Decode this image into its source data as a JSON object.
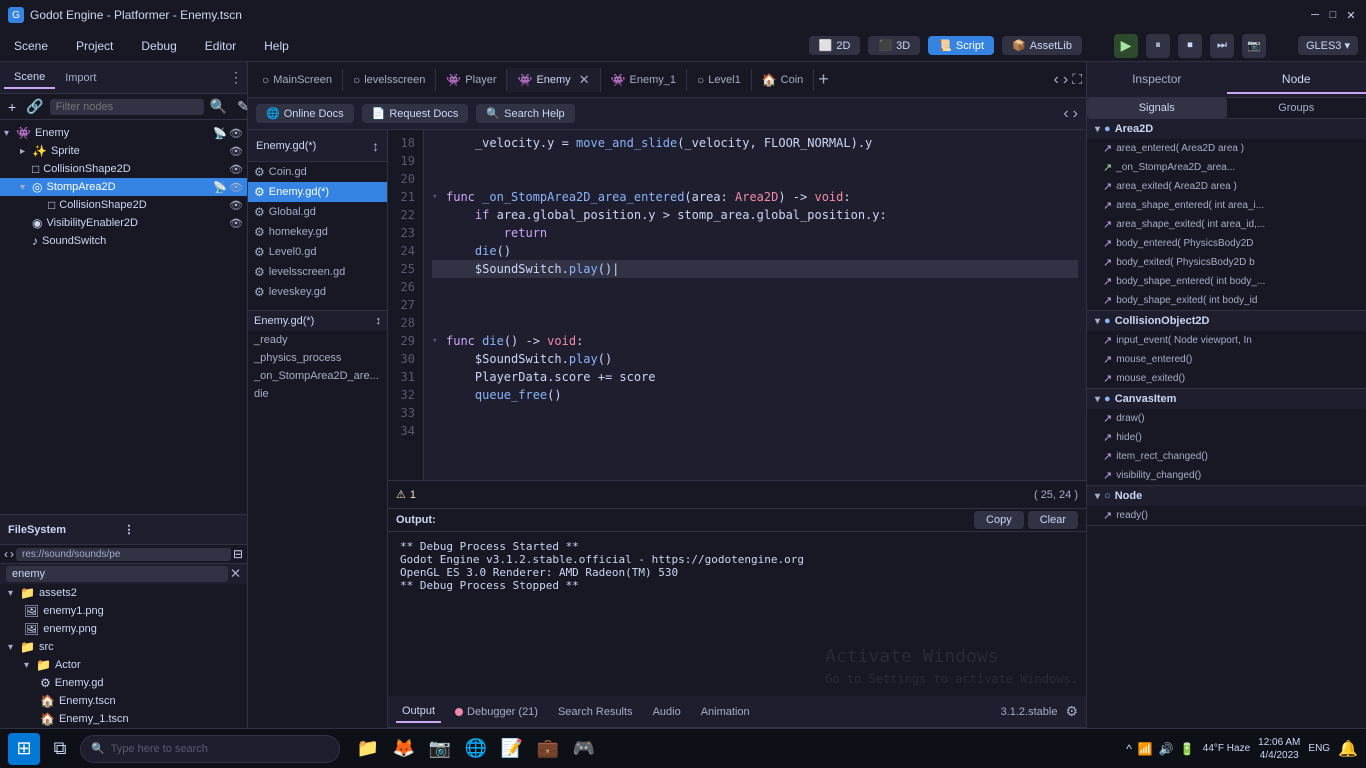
{
  "window": {
    "title": "Godot Engine - Platformer - Enemy.tscn",
    "controls": [
      "─",
      "□",
      "✕"
    ]
  },
  "menubar": {
    "items": [
      "Scene",
      "Project",
      "Debug",
      "Editor",
      "Help"
    ],
    "toolbar": {
      "buttons": [
        "2D",
        "3D",
        "Script",
        "AssetLib"
      ],
      "active": "Script"
    },
    "play_controls": [
      "▶",
      "⏸",
      "⏹",
      "⏭",
      "📷"
    ],
    "gles": "GLES3 ▾"
  },
  "scene_panel": {
    "tabs": [
      "Scene",
      "Import"
    ],
    "toolbar_actions": [
      "+",
      "🔗",
      "🔍",
      "✎"
    ],
    "filter_placeholder": "Filter nodes",
    "tree": [
      {
        "level": 0,
        "icon": "👾",
        "name": "Enemy",
        "actions": [
          "📡",
          "👁"
        ]
      },
      {
        "level": 1,
        "icon": "✨",
        "name": "Sprite",
        "actions": [
          "👁"
        ]
      },
      {
        "level": 1,
        "icon": "□",
        "name": "CollisionShape2D",
        "actions": [
          "👁"
        ]
      },
      {
        "level": 1,
        "icon": "◎",
        "name": "StompArea2D",
        "selected": true,
        "actions": [
          "📡",
          "👁"
        ]
      },
      {
        "level": 2,
        "icon": "□",
        "name": "CollisionShape2D",
        "actions": [
          "👁"
        ]
      },
      {
        "level": 1,
        "icon": "◉",
        "name": "VisibilityEnabler2D",
        "actions": [
          "👁"
        ]
      },
      {
        "level": 1,
        "icon": "♪",
        "name": "SoundSwitch",
        "actions": []
      }
    ]
  },
  "file_tabs": [
    {
      "label": "MainScreen",
      "icon": "○",
      "active": false,
      "closable": false
    },
    {
      "label": "levelsscreen",
      "icon": "○",
      "active": false,
      "closable": false
    },
    {
      "label": "Player",
      "icon": "👾",
      "active": false,
      "closable": false
    },
    {
      "label": "Enemy",
      "icon": "👾",
      "active": true,
      "closable": true
    },
    {
      "label": "Enemy_1",
      "icon": "👾",
      "active": false,
      "closable": false
    },
    {
      "label": "Level1",
      "icon": "○",
      "active": false,
      "closable": false
    },
    {
      "label": "Coin",
      "icon": "🏠",
      "active": false,
      "closable": false
    }
  ],
  "doc_toolbar": {
    "buttons": [
      "Online Docs",
      "Request Docs",
      "Search Help"
    ]
  },
  "script_list": {
    "header": "Enemy.gd(*)",
    "items": [
      {
        "label": "Coin.gd",
        "icon": "⚙"
      },
      {
        "label": "Enemy.gd(*)",
        "icon": "⚙",
        "active": true
      },
      {
        "label": "Global.gd",
        "icon": "⚙"
      },
      {
        "label": "homekey.gd",
        "icon": "⚙"
      },
      {
        "label": "Level0.gd",
        "icon": "⚙"
      },
      {
        "label": "levelsscreen.gd",
        "icon": "⚙"
      },
      {
        "label": "leveskey.gd",
        "icon": "⚙"
      }
    ],
    "current": "Enemy.gd(*)"
  },
  "code_editor": {
    "lines": [
      {
        "num": 18,
        "content": "\t_velocity.y = move_and_slide(_velocity, FLOOR_NORMAL).y",
        "tokens": [
          {
            "t": "\t_velocity.y = ",
            "c": "var"
          },
          {
            "t": "move_and_slide",
            "c": "fn"
          },
          {
            "t": "(_velocity, ",
            "c": "var"
          },
          {
            "t": "FLOOR_NORMAL",
            "c": "var"
          },
          {
            "t": ").y",
            "c": "var"
          }
        ]
      },
      {
        "num": 19,
        "content": ""
      },
      {
        "num": 20,
        "content": ""
      },
      {
        "num": 21,
        "content": "func _on_StompArea2D_area_entered(area: Area2D) -> void:",
        "tokens": [
          {
            "t": "func ",
            "c": "kw"
          },
          {
            "t": "_on_StompArea2D_area_entered",
            "c": "fn"
          },
          {
            "t": "(area: ",
            "c": "var"
          },
          {
            "t": "Area2D",
            "c": "type"
          },
          {
            "t": ") -> ",
            "c": "var"
          },
          {
            "t": "void",
            "c": "type"
          },
          {
            "t": ":",
            "c": "var"
          }
        ]
      },
      {
        "num": 22,
        "content": "\tif area.global_position.y > stomp_area.global_position.y:",
        "tokens": [
          {
            "t": "\t",
            "c": "var"
          },
          {
            "t": "if",
            "c": "kw"
          },
          {
            "t": " area.global_position.y > stomp_area.global_position.y:",
            "c": "var"
          }
        ]
      },
      {
        "num": 23,
        "content": "\t\treturn",
        "tokens": [
          {
            "t": "\t\t",
            "c": "var"
          },
          {
            "t": "return",
            "c": "kw"
          }
        ]
      },
      {
        "num": 24,
        "content": "\tdie()",
        "tokens": [
          {
            "t": "\t",
            "c": "var"
          },
          {
            "t": "die",
            "c": "fn"
          },
          {
            "t": "()",
            "c": "var"
          }
        ]
      },
      {
        "num": 25,
        "content": "\t$SoundSwitch.play()|",
        "tokens": [
          {
            "t": "\t$SoundSwitch.",
            "c": "var"
          },
          {
            "t": "play",
            "c": "fn"
          },
          {
            "t": "()|",
            "c": "var"
          }
        ],
        "highlighted": true
      },
      {
        "num": 26,
        "content": ""
      },
      {
        "num": 27,
        "content": ""
      },
      {
        "num": 28,
        "content": ""
      },
      {
        "num": 29,
        "content": "func die() -> void:",
        "tokens": [
          {
            "t": "func ",
            "c": "kw"
          },
          {
            "t": "die",
            "c": "fn"
          },
          {
            "t": "() -> ",
            "c": "var"
          },
          {
            "t": "void",
            "c": "type"
          },
          {
            "t": ":",
            "c": "var"
          }
        ]
      },
      {
        "num": 30,
        "content": "\t$SoundSwitch.play()",
        "tokens": [
          {
            "t": "\t$SoundSwitch.",
            "c": "var"
          },
          {
            "t": "play",
            "c": "fn"
          },
          {
            "t": "()",
            "c": "var"
          }
        ]
      },
      {
        "num": 31,
        "content": "\tPlayerData.score += score",
        "tokens": [
          {
            "t": "\tPlayerData.score += score",
            "c": "var"
          }
        ]
      },
      {
        "num": 32,
        "content": "\tqueue_free()",
        "tokens": [
          {
            "t": "\t",
            "c": "var"
          },
          {
            "t": "queue_free",
            "c": "fn"
          },
          {
            "t": "()",
            "c": "var"
          }
        ]
      },
      {
        "num": 33,
        "content": ""
      },
      {
        "num": 34,
        "content": ""
      }
    ],
    "status": {
      "warning_count": 1,
      "position": "( 25, 24 )"
    }
  },
  "methods": {
    "label": "Enemy.gd(*)",
    "items": [
      "_ready",
      "_physics_process",
      "_on_StompArea2D_are...",
      "die"
    ]
  },
  "output": {
    "header_label": "Output:",
    "copy_btn": "Copy",
    "clear_btn": "Clear",
    "content": [
      "** Debug Process Started **",
      "Godot Engine v3.1.2.stable.official - https://godotengine.org",
      "OpenGL ES 3.0 Renderer: AMD Radeon(TM) 530",
      "** Debug Process Stopped **"
    ],
    "tabs": [
      {
        "label": "Output",
        "active": true,
        "dot": false
      },
      {
        "label": "Debugger (21)",
        "active": false,
        "dot": true
      },
      {
        "label": "Search Results",
        "active": false,
        "dot": false
      },
      {
        "label": "Audio",
        "active": false,
        "dot": false
      },
      {
        "label": "Animation",
        "active": false,
        "dot": false
      }
    ],
    "version": "3.1.2.stable"
  },
  "inspector": {
    "header_tabs": [
      "Inspector",
      "Node"
    ],
    "active_tab": "Node",
    "inner_tabs": [
      "Signals",
      "Groups"
    ],
    "active_inner": "Signals",
    "sections": [
      {
        "name": "Area2D",
        "expanded": true,
        "signals": [
          {
            "label": "area_entered( Area2D area )",
            "connected": true
          },
          {
            "label": "_on_StompArea2D_area...",
            "connected": true
          },
          {
            "label": "area_exited( Area2D area )",
            "connected": false
          },
          {
            "label": "area_shape_entered( int area_i...",
            "connected": false
          },
          {
            "label": "area_shape_exited( int area_id,...",
            "connected": false
          },
          {
            "label": "body_entered( PhysicsBody2D",
            "connected": false
          },
          {
            "label": "body_exited( PhysicsBody2D b",
            "connected": false
          },
          {
            "label": "body_shape_entered( int body_...",
            "connected": false
          },
          {
            "label": "body_shape_exited( int body_id",
            "connected": false
          }
        ]
      },
      {
        "name": "CollisionObject2D",
        "expanded": true,
        "signals": [
          {
            "label": "input_event( Node viewport, In",
            "connected": false
          },
          {
            "label": "mouse_entered()",
            "connected": false
          },
          {
            "label": "mouse_exited()",
            "connected": false
          }
        ]
      },
      {
        "name": "CanvasItem",
        "expanded": true,
        "signals": [
          {
            "label": "draw()",
            "connected": false
          },
          {
            "label": "hide()",
            "connected": false
          },
          {
            "label": "item_rect_changed()",
            "connected": false
          },
          {
            "label": "visibility_changed()",
            "connected": false
          }
        ]
      },
      {
        "name": "Node",
        "expanded": true,
        "signals": [
          {
            "label": "ready()",
            "connected": false
          }
        ]
      }
    ]
  },
  "filesystem": {
    "header": "FileSystem",
    "path": "res://sound/sounds/pe",
    "search_value": "enemy",
    "tree": [
      {
        "level": 0,
        "icon": "📁",
        "name": "assets2",
        "type": "folder"
      },
      {
        "level": 1,
        "icon": "🖼",
        "name": "enemy1.png",
        "type": "file"
      },
      {
        "level": 1,
        "icon": "🖼",
        "name": "enemy.png",
        "type": "file"
      },
      {
        "level": 0,
        "icon": "📁",
        "name": "src",
        "type": "folder"
      },
      {
        "level": 1,
        "icon": "📁",
        "name": "Actor",
        "type": "folder"
      },
      {
        "level": 2,
        "icon": "⚙",
        "name": "Enemy.gd",
        "type": "file"
      },
      {
        "level": 2,
        "icon": "🏠",
        "name": "Enemy.tscn",
        "type": "file"
      },
      {
        "level": 2,
        "icon": "🏠",
        "name": "Enemy_1.tscn",
        "type": "file"
      }
    ]
  },
  "taskbar": {
    "search_placeholder": "Type here to search",
    "sys_info": {
      "temp": "44°F",
      "weather": "Haze",
      "time": "12:06 AM",
      "date": "4/4/2023",
      "lang": "ENG"
    },
    "notification": "Activate Windows\nGo to Settings to activate Windows."
  }
}
